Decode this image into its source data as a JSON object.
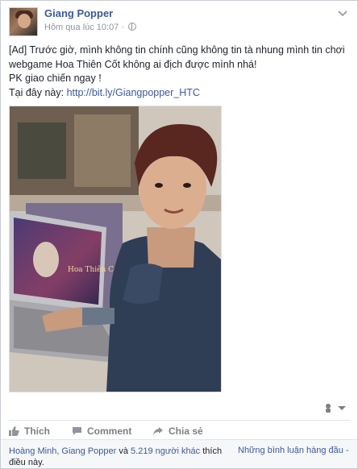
{
  "post": {
    "author": "Giang Popper",
    "timestamp": "Hôm qua lúc 10:07",
    "separator": "·",
    "privacy_icon": "globe-icon",
    "text_line1": "[Ad] Trước giờ, mình không tin chính cũng không tin tà nhung mình tin chơi webgame Hoa Thiên Cốt không ai địch được mình nhá!",
    "text_line2": "PK giao chiến ngay !",
    "text_line3_prefix": "Tại đây này: ",
    "link": "http://bit.ly/Giangpopper_HTC",
    "photo_alt_text": "Hoa Thiên Cốt"
  },
  "actions": {
    "like": "Thích",
    "comment": "Comment",
    "share": "Chia sẻ"
  },
  "likes": {
    "names": "Hoàng Minh, Giang Popper",
    "middle": " và ",
    "count": "5.219 người khác",
    "suffix": " thích điều này."
  },
  "comments": {
    "sort_label": "Những bình luận hàng đầu -"
  },
  "colors": {
    "link": "#3b5998",
    "text": "#1d2129",
    "muted": "#90949c"
  }
}
